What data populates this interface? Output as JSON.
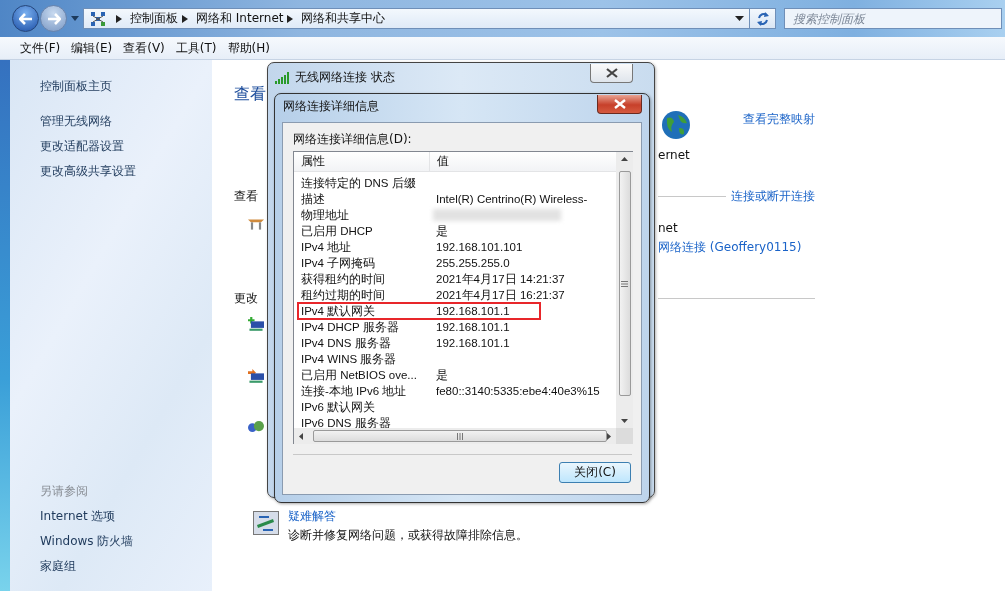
{
  "window": {
    "breadcrumbs": [
      "控制面板",
      "网络和 Internet",
      "网络和共享中心"
    ],
    "search": {
      "placeholder": "搜索控制面板"
    }
  },
  "menu": [
    "文件(F)",
    "编辑(E)",
    "查看(V)",
    "工具(T)",
    "帮助(H)"
  ],
  "sidebar": {
    "items": [
      {
        "label": "控制面板主页",
        "kind": "home"
      },
      {
        "label": "管理无线网络",
        "kind": "task"
      },
      {
        "label": "更改适配器设置",
        "kind": "task"
      },
      {
        "label": "更改高级共享设置",
        "kind": "task"
      }
    ],
    "see_also": {
      "title": "另请参阅",
      "items": [
        "Internet 选项",
        "Windows 防火墙",
        "家庭组"
      ]
    }
  },
  "main": {
    "heading": "查看",
    "map_link": "查看完整映射",
    "internet_label": "ernet",
    "active_heading": "查看",
    "connect_link": "连接或断开连接",
    "access_label": "net",
    "connection_link": "网络连接 (Geoffery0115)",
    "change_heading": "更改",
    "task": {
      "title": "疑难解答",
      "description": "诊断并修复网络问题，或获得故障排除信息。"
    }
  },
  "status_window": {
    "title": "无线网络连接 状态"
  },
  "details_dialog": {
    "title": "网络连接详细信息",
    "list_label": "网络连接详细信息(D):",
    "columns": [
      "属性",
      "值"
    ],
    "rows": [
      {
        "property": "连接特定的 DNS 后缀",
        "redacted": false,
        "highlighted": false
      },
      {
        "property": "描述",
        "value": "Intel(R) Centrino(R) Wireless-",
        "redacted": false,
        "highlighted": false
      },
      {
        "property": "物理地址",
        "redacted": true,
        "highlighted": false
      },
      {
        "property": "已启用 DHCP",
        "value": "是",
        "redacted": false,
        "highlighted": false
      },
      {
        "property": "IPv4 地址",
        "value": "192.168.101.101",
        "redacted": false,
        "highlighted": false
      },
      {
        "property": "IPv4 子网掩码",
        "value": "255.255.255.0",
        "redacted": false,
        "highlighted": false
      },
      {
        "property": "获得租约的时间",
        "value": "2021年4月17日 14:21:37",
        "redacted": false,
        "highlighted": false
      },
      {
        "property": "租约过期的时间",
        "value": "2021年4月17日 16:21:37",
        "redacted": false,
        "highlighted": false
      },
      {
        "property": "IPv4 默认网关",
        "value": "192.168.101.1",
        "redacted": false,
        "highlighted": true
      },
      {
        "property": "IPv4 DHCP 服务器",
        "value": "192.168.101.1",
        "redacted": false,
        "highlighted": false
      },
      {
        "property": "IPv4 DNS 服务器",
        "value": "192.168.101.1",
        "redacted": false,
        "highlighted": false
      },
      {
        "property": "IPv4 WINS 服务器",
        "redacted": false,
        "highlighted": false
      },
      {
        "property": "已启用 NetBIOS ove...",
        "value": "是",
        "redacted": false,
        "highlighted": false
      },
      {
        "property": "连接-本地 IPv6 地址",
        "value": "fe80::3140:5335:ebe4:40e3%15",
        "redacted": false,
        "highlighted": false
      },
      {
        "property": "IPv6 默认网关",
        "redacted": false,
        "highlighted": false
      },
      {
        "property": "IPv6 DNS 服务器",
        "redacted": false,
        "highlighted": false
      }
    ],
    "close_button": "关闭(C)"
  }
}
